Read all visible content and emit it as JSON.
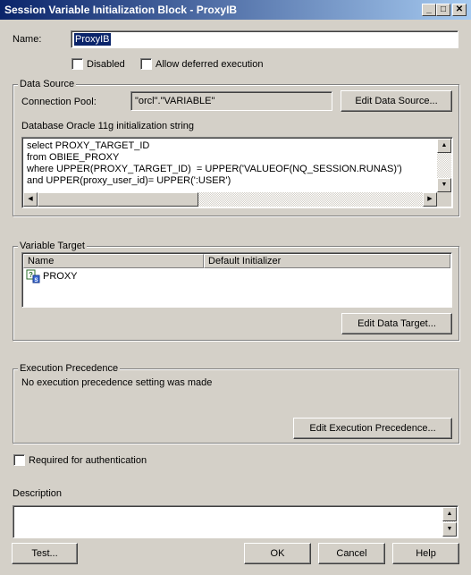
{
  "window": {
    "title": "Session Variable Initialization Block - ProxyIB",
    "minimize": "_",
    "maximize": "□",
    "close": "✕"
  },
  "name_field": {
    "label": "Name:",
    "value": "ProxyIB"
  },
  "options": {
    "disabled_label": "Disabled",
    "disabled_checked": false,
    "deferred_label": "Allow deferred execution",
    "deferred_checked": false
  },
  "data_source": {
    "group_label": "Data Source",
    "connection_pool_label": "Connection Pool:",
    "connection_pool_value": "\"orcl\".\"VARIABLE\"",
    "edit_button": "Edit Data Source...",
    "init_string_label": "Database Oracle 11g initialization string",
    "sql_lines": [
      "select PROXY_TARGET_ID",
      "from OBIEE_PROXY",
      "where UPPER(PROXY_TARGET_ID)  = UPPER('VALUEOF(NQ_SESSION.RUNAS)')",
      "and UPPER(proxy_user_id)= UPPER(':USER')"
    ]
  },
  "variable_target": {
    "group_label": "Variable Target",
    "columns": [
      "Name",
      "Default Initializer"
    ],
    "rows": [
      {
        "name": "PROXY",
        "default": ""
      }
    ],
    "edit_button": "Edit Data Target..."
  },
  "execution_precedence": {
    "group_label": "Execution Precedence",
    "message": "No execution precedence setting was made",
    "edit_button": "Edit Execution Precedence..."
  },
  "auth": {
    "label": "Required for authentication",
    "checked": false
  },
  "description": {
    "label": "Description",
    "value": ""
  },
  "buttons": {
    "test": "Test...",
    "ok": "OK",
    "cancel": "Cancel",
    "help": "Help"
  },
  "icons": {
    "variable_row_icon": "session-variable-icon",
    "scroll_up": "▲",
    "scroll_down": "▼",
    "scroll_left": "◀",
    "scroll_right": "▶"
  },
  "colors": {
    "title_start": "#0a246a",
    "title_end": "#a6caf0",
    "dialog_bg": "#d4d0c8",
    "name_selection": "#0a246a"
  }
}
